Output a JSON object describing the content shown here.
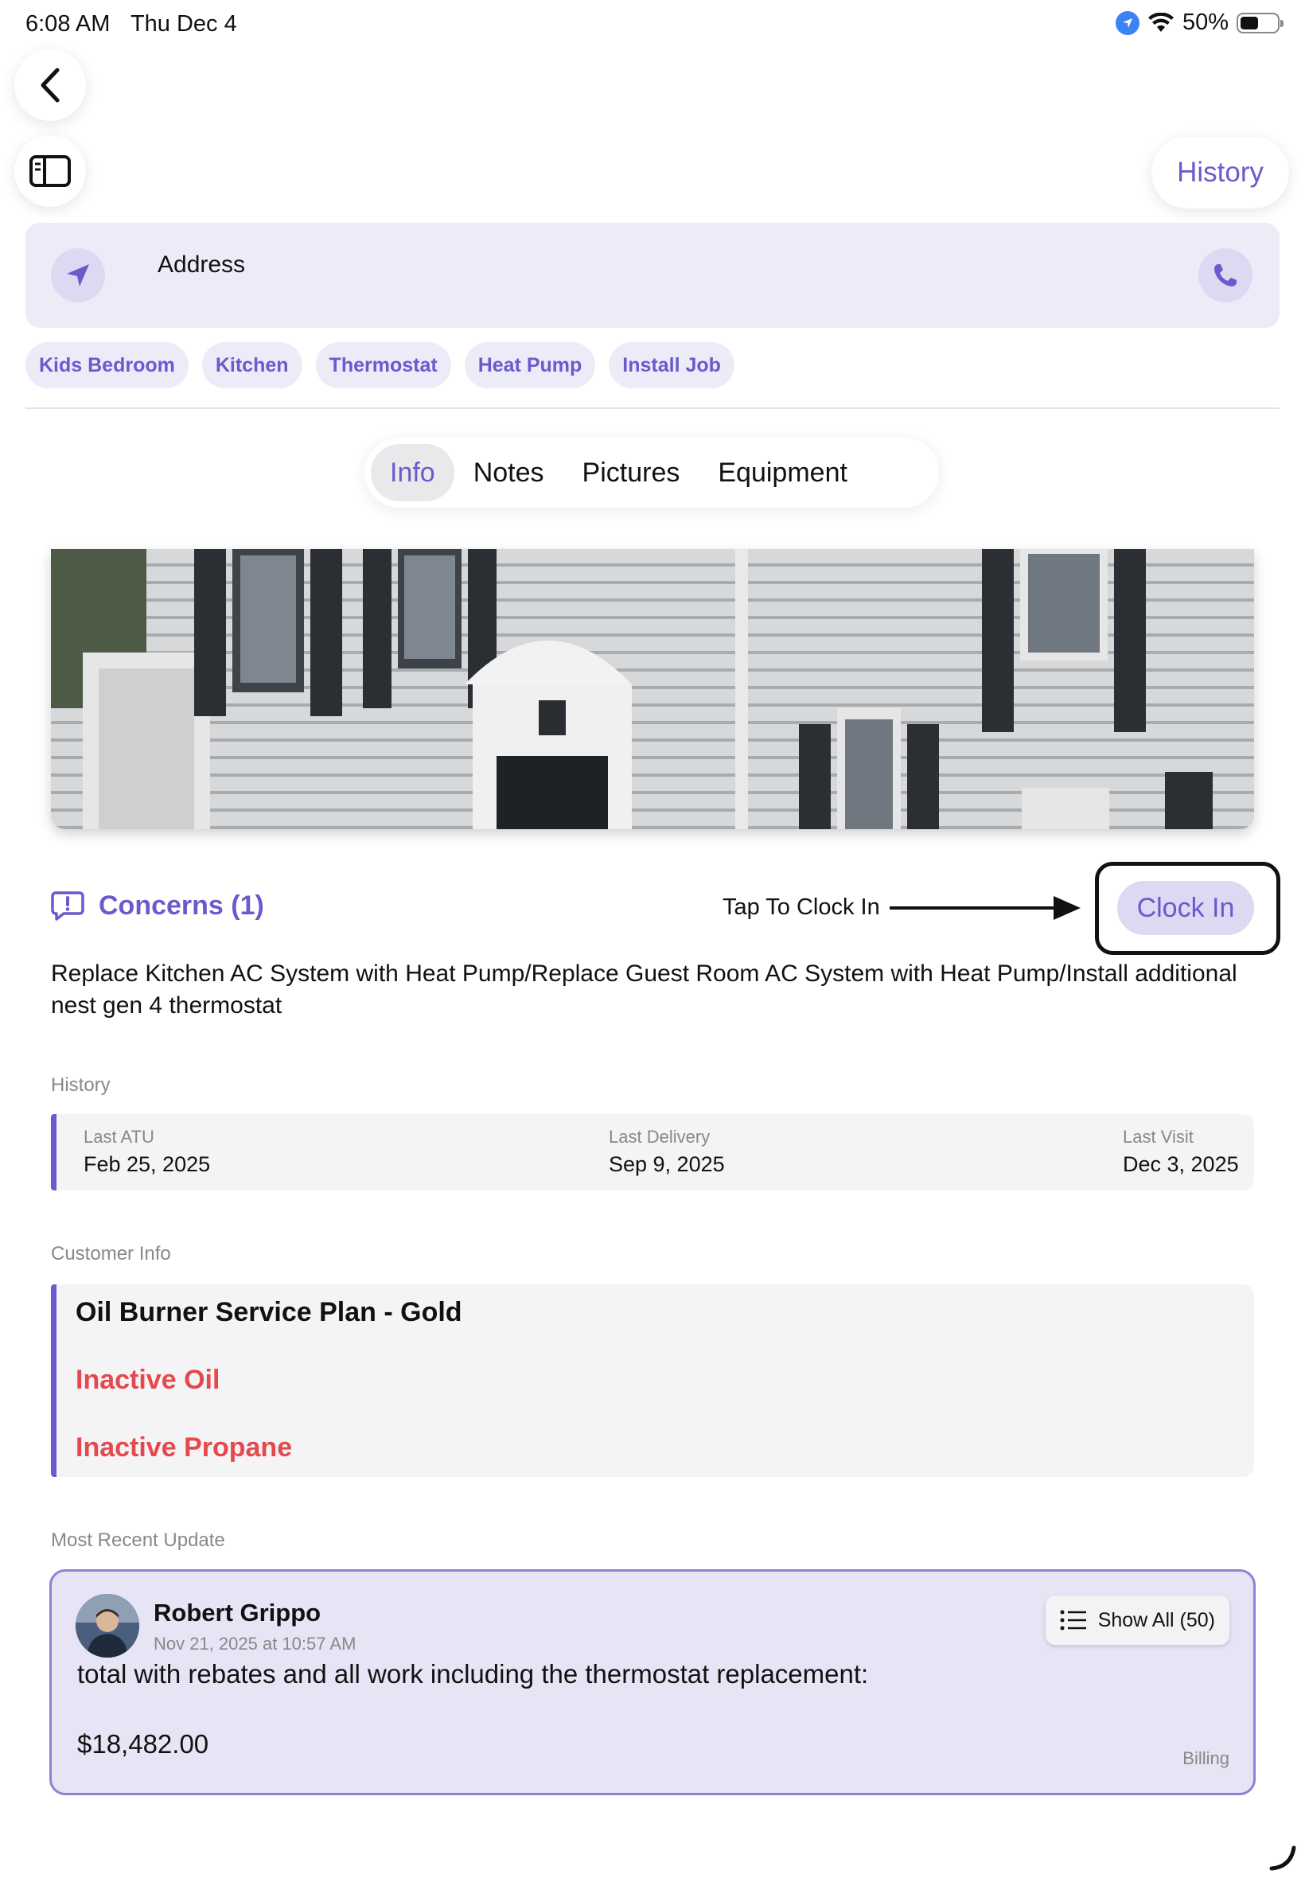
{
  "status_bar": {
    "time": "6:08 AM",
    "date": "Thu Dec 4",
    "battery": "50%",
    "battery_level": 0.5
  },
  "header": {
    "history_label": "History"
  },
  "address": {
    "label": "Address"
  },
  "tags": [
    "Kids Bedroom",
    "Kitchen",
    "Thermostat",
    "Heat Pump",
    "Install Job"
  ],
  "tabs": [
    {
      "label": "Info",
      "active": true
    },
    {
      "label": "Notes",
      "active": false
    },
    {
      "label": "Pictures",
      "active": false
    },
    {
      "label": "Equipment",
      "active": false
    }
  ],
  "concerns": {
    "label": "Concerns (1)",
    "text": "Replace Kitchen AC System with Heat Pump/Replace Guest Room AC System with Heat Pump/Install additional nest gen 4 thermostat"
  },
  "clock_in": {
    "hint": "Tap To Clock In",
    "button_label": "Clock In"
  },
  "history": {
    "section_label": "History",
    "items": [
      {
        "label": "Last ATU",
        "value": "Feb 25, 2025"
      },
      {
        "label": "Last Delivery",
        "value": "Sep 9, 2025"
      },
      {
        "label": "Last Visit",
        "value": "Dec 3, 2025"
      }
    ]
  },
  "customer_info": {
    "section_label": "Customer Info",
    "plan": "Oil Burner Service Plan - Gold",
    "statuses": [
      "Inactive Oil",
      "Inactive Propane"
    ]
  },
  "recent_update": {
    "section_label": "Most Recent Update",
    "author": "Robert Grippo",
    "timestamp": "Nov 21, 2025 at 10:57 AM",
    "show_all_label": "Show All (50)",
    "message": "total with rebates and all work including the thermostat replacement:",
    "amount": "$18,482.00",
    "category": "Billing"
  },
  "colors": {
    "accent": "#6a5acd",
    "accent_light": "#ecebf8",
    "warning": "#e5484d"
  }
}
